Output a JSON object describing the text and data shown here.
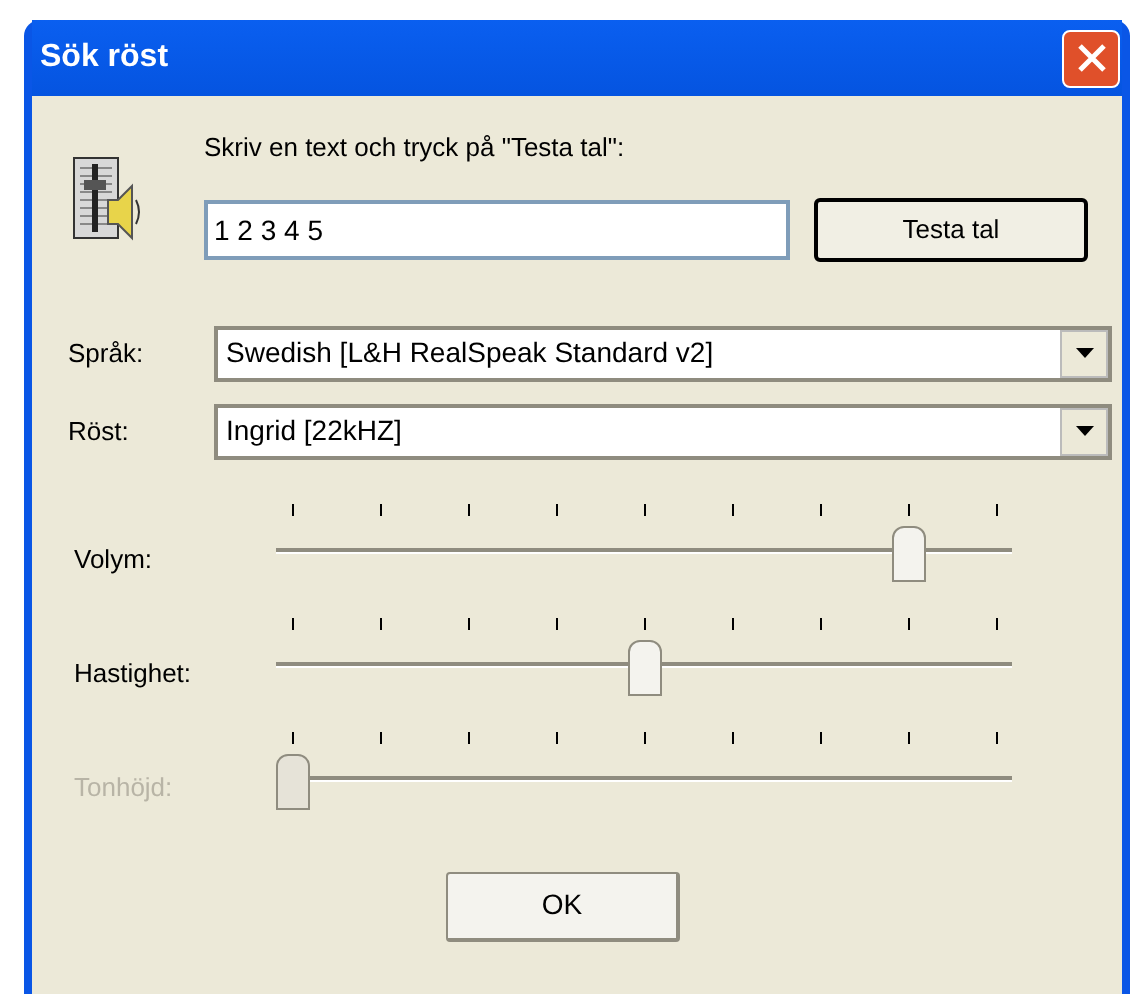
{
  "window": {
    "title": "Sök röst"
  },
  "prompt": "Skriv en text och tryck på \"Testa tal\":",
  "text_field": {
    "value": "1 2 3 4 5"
  },
  "test_button": "Testa tal",
  "dropdowns": [
    {
      "label": "Språk:",
      "value": "Swedish [L&H RealSpeak Standard v2]"
    },
    {
      "label": "Röst:",
      "value": "Ingrid [22kHZ]"
    }
  ],
  "sliders": [
    {
      "label": "Volym:",
      "level": 0.875,
      "disabled": false
    },
    {
      "label": "Hastighet:",
      "level": 0.5,
      "disabled": false
    },
    {
      "label": "Tonhöjd:",
      "level": 0,
      "disabled": true
    }
  ],
  "ok_button": "OK"
}
